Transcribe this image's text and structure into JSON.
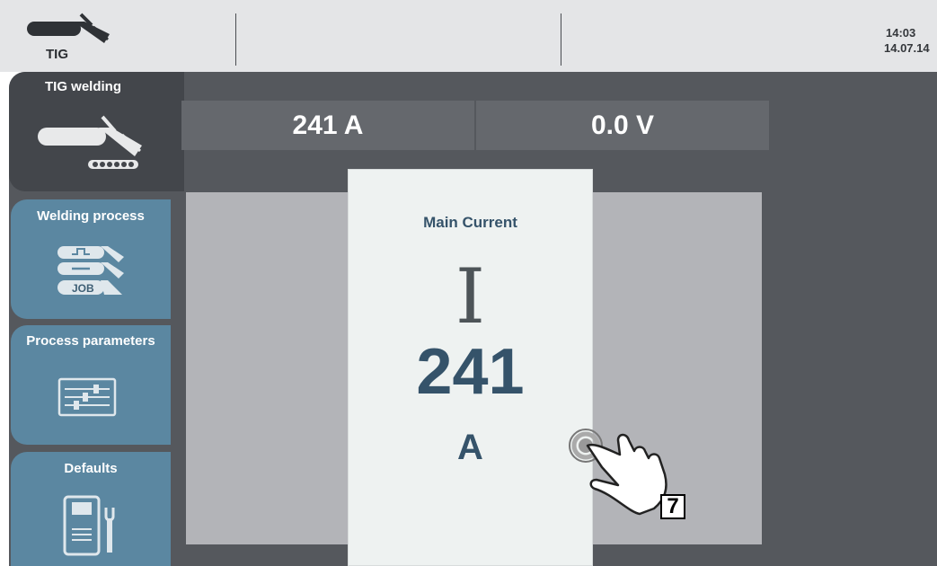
{
  "status": {
    "mode": "TIG",
    "time": "14:03",
    "date": "14.07.14"
  },
  "card": {
    "title": "TIG welding"
  },
  "readouts": {
    "current": "241 A",
    "voltage": "0.0 V"
  },
  "side": {
    "welding_process": "Welding process",
    "process_parameters": "Process parameters",
    "defaults": "Defaults",
    "job_label": "JOB"
  },
  "popup": {
    "title": "Main Current",
    "symbol": "I",
    "value": "241",
    "unit": "A"
  },
  "callout": {
    "step": "7"
  },
  "colors": {
    "accent": "#5b87a1",
    "panel": "#55585d",
    "value_text": "#35536a"
  },
  "icons": [
    "tig-torch-icon",
    "tig-torch-electrode-icon",
    "welding-process-icon",
    "process-parameters-icon",
    "defaults-icon",
    "touch-hand-icon"
  ]
}
